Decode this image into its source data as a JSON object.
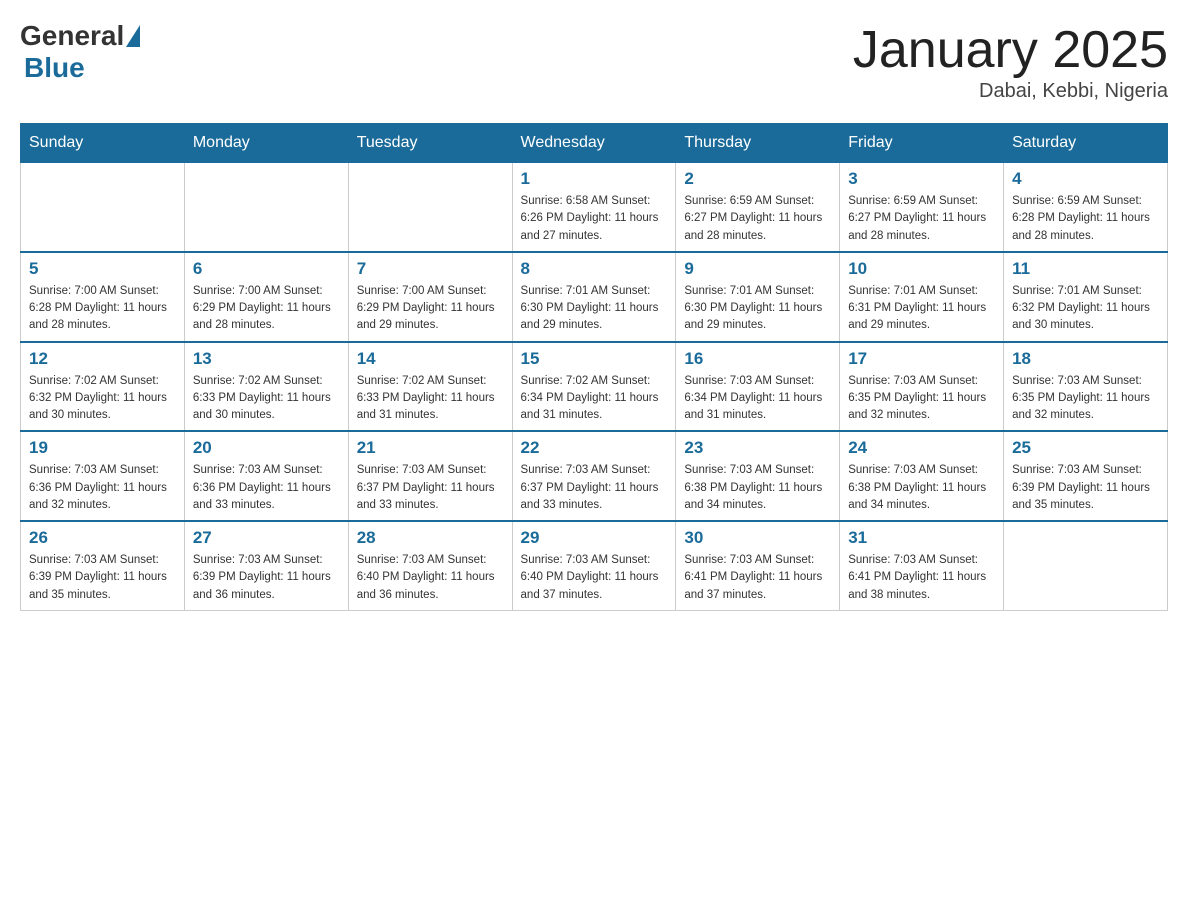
{
  "header": {
    "logo": {
      "general": "General",
      "blue": "Blue"
    },
    "title": "January 2025",
    "location": "Dabai, Kebbi, Nigeria"
  },
  "days_of_week": [
    "Sunday",
    "Monday",
    "Tuesday",
    "Wednesday",
    "Thursday",
    "Friday",
    "Saturday"
  ],
  "weeks": [
    [
      {
        "day": "",
        "info": ""
      },
      {
        "day": "",
        "info": ""
      },
      {
        "day": "",
        "info": ""
      },
      {
        "day": "1",
        "info": "Sunrise: 6:58 AM\nSunset: 6:26 PM\nDaylight: 11 hours and 27 minutes."
      },
      {
        "day": "2",
        "info": "Sunrise: 6:59 AM\nSunset: 6:27 PM\nDaylight: 11 hours and 28 minutes."
      },
      {
        "day": "3",
        "info": "Sunrise: 6:59 AM\nSunset: 6:27 PM\nDaylight: 11 hours and 28 minutes."
      },
      {
        "day": "4",
        "info": "Sunrise: 6:59 AM\nSunset: 6:28 PM\nDaylight: 11 hours and 28 minutes."
      }
    ],
    [
      {
        "day": "5",
        "info": "Sunrise: 7:00 AM\nSunset: 6:28 PM\nDaylight: 11 hours and 28 minutes."
      },
      {
        "day": "6",
        "info": "Sunrise: 7:00 AM\nSunset: 6:29 PM\nDaylight: 11 hours and 28 minutes."
      },
      {
        "day": "7",
        "info": "Sunrise: 7:00 AM\nSunset: 6:29 PM\nDaylight: 11 hours and 29 minutes."
      },
      {
        "day": "8",
        "info": "Sunrise: 7:01 AM\nSunset: 6:30 PM\nDaylight: 11 hours and 29 minutes."
      },
      {
        "day": "9",
        "info": "Sunrise: 7:01 AM\nSunset: 6:30 PM\nDaylight: 11 hours and 29 minutes."
      },
      {
        "day": "10",
        "info": "Sunrise: 7:01 AM\nSunset: 6:31 PM\nDaylight: 11 hours and 29 minutes."
      },
      {
        "day": "11",
        "info": "Sunrise: 7:01 AM\nSunset: 6:32 PM\nDaylight: 11 hours and 30 minutes."
      }
    ],
    [
      {
        "day": "12",
        "info": "Sunrise: 7:02 AM\nSunset: 6:32 PM\nDaylight: 11 hours and 30 minutes."
      },
      {
        "day": "13",
        "info": "Sunrise: 7:02 AM\nSunset: 6:33 PM\nDaylight: 11 hours and 30 minutes."
      },
      {
        "day": "14",
        "info": "Sunrise: 7:02 AM\nSunset: 6:33 PM\nDaylight: 11 hours and 31 minutes."
      },
      {
        "day": "15",
        "info": "Sunrise: 7:02 AM\nSunset: 6:34 PM\nDaylight: 11 hours and 31 minutes."
      },
      {
        "day": "16",
        "info": "Sunrise: 7:03 AM\nSunset: 6:34 PM\nDaylight: 11 hours and 31 minutes."
      },
      {
        "day": "17",
        "info": "Sunrise: 7:03 AM\nSunset: 6:35 PM\nDaylight: 11 hours and 32 minutes."
      },
      {
        "day": "18",
        "info": "Sunrise: 7:03 AM\nSunset: 6:35 PM\nDaylight: 11 hours and 32 minutes."
      }
    ],
    [
      {
        "day": "19",
        "info": "Sunrise: 7:03 AM\nSunset: 6:36 PM\nDaylight: 11 hours and 32 minutes."
      },
      {
        "day": "20",
        "info": "Sunrise: 7:03 AM\nSunset: 6:36 PM\nDaylight: 11 hours and 33 minutes."
      },
      {
        "day": "21",
        "info": "Sunrise: 7:03 AM\nSunset: 6:37 PM\nDaylight: 11 hours and 33 minutes."
      },
      {
        "day": "22",
        "info": "Sunrise: 7:03 AM\nSunset: 6:37 PM\nDaylight: 11 hours and 33 minutes."
      },
      {
        "day": "23",
        "info": "Sunrise: 7:03 AM\nSunset: 6:38 PM\nDaylight: 11 hours and 34 minutes."
      },
      {
        "day": "24",
        "info": "Sunrise: 7:03 AM\nSunset: 6:38 PM\nDaylight: 11 hours and 34 minutes."
      },
      {
        "day": "25",
        "info": "Sunrise: 7:03 AM\nSunset: 6:39 PM\nDaylight: 11 hours and 35 minutes."
      }
    ],
    [
      {
        "day": "26",
        "info": "Sunrise: 7:03 AM\nSunset: 6:39 PM\nDaylight: 11 hours and 35 minutes."
      },
      {
        "day": "27",
        "info": "Sunrise: 7:03 AM\nSunset: 6:39 PM\nDaylight: 11 hours and 36 minutes."
      },
      {
        "day": "28",
        "info": "Sunrise: 7:03 AM\nSunset: 6:40 PM\nDaylight: 11 hours and 36 minutes."
      },
      {
        "day": "29",
        "info": "Sunrise: 7:03 AM\nSunset: 6:40 PM\nDaylight: 11 hours and 37 minutes."
      },
      {
        "day": "30",
        "info": "Sunrise: 7:03 AM\nSunset: 6:41 PM\nDaylight: 11 hours and 37 minutes."
      },
      {
        "day": "31",
        "info": "Sunrise: 7:03 AM\nSunset: 6:41 PM\nDaylight: 11 hours and 38 minutes."
      },
      {
        "day": "",
        "info": ""
      }
    ]
  ]
}
